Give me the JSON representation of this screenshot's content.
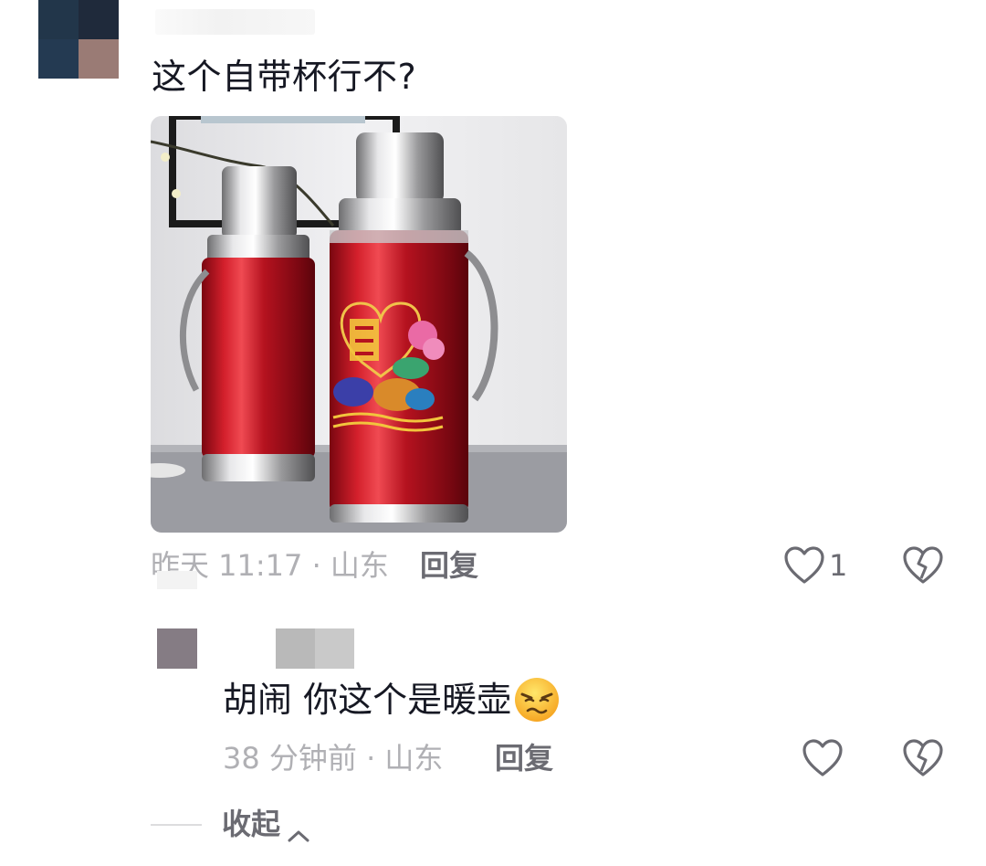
{
  "comment": {
    "text": "这个自带杯行不?",
    "image_alt": "thermos-photo",
    "meta": "昨天 11:17 · 山东",
    "reply_label": "回复",
    "like_count": "1",
    "icons": {
      "like": "heart-outline-icon",
      "dislike": "broken-heart-icon"
    }
  },
  "reply": {
    "text": "胡闹 你这个是暖壶",
    "emoji": "annoyed-face-emoji",
    "meta": "38 分钟前 · 山东",
    "reply_label": "回复",
    "icons": {
      "like": "heart-outline-icon",
      "dislike": "broken-heart-icon"
    }
  },
  "collapse": {
    "label": "收起"
  },
  "colors": {
    "text_primary": "#161823",
    "text_secondary": "#b0b0b4",
    "action_text": "#6b6b72",
    "thermos_red": "#b5121f"
  }
}
